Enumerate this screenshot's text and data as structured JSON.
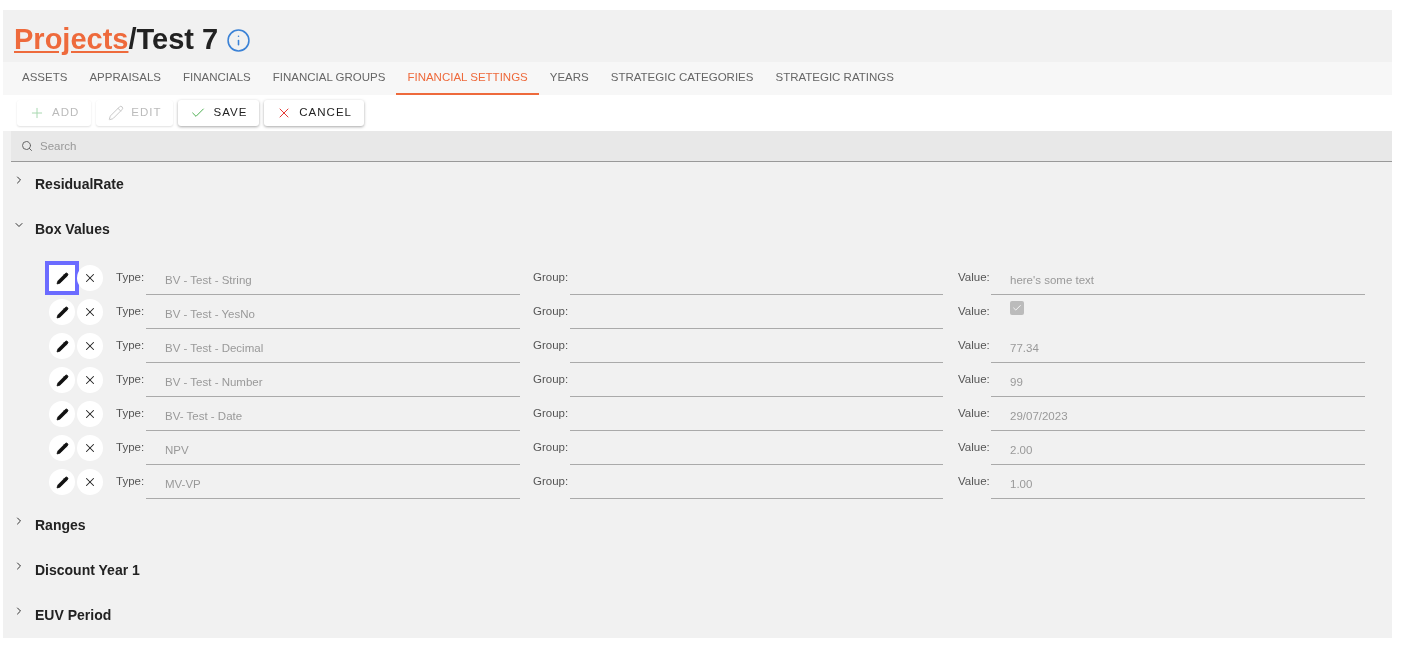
{
  "breadcrumb": {
    "link": "Projects",
    "separator": "/",
    "title": "Test 7"
  },
  "tabs": [
    {
      "label": "ASSETS",
      "selected": false
    },
    {
      "label": "APPRAISALS",
      "selected": false
    },
    {
      "label": "FINANCIALS",
      "selected": false
    },
    {
      "label": "FINANCIAL GROUPS",
      "selected": false
    },
    {
      "label": "FINANCIAL SETTINGS",
      "selected": true
    },
    {
      "label": "YEARS",
      "selected": false
    },
    {
      "label": "STRATEGIC CATEGORIES",
      "selected": false
    },
    {
      "label": "STRATEGIC RATINGS",
      "selected": false
    }
  ],
  "toolbar": [
    {
      "kind": "add",
      "label": "ADD",
      "disabled": true
    },
    {
      "kind": "edit",
      "label": "EDIT",
      "disabled": true
    },
    {
      "kind": "save",
      "label": "SAVE",
      "disabled": false
    },
    {
      "kind": "cancel",
      "label": "CANCEL",
      "disabled": false
    }
  ],
  "search": {
    "placeholder": "Search"
  },
  "sections": [
    {
      "title": "ResidualRate",
      "expanded": false
    },
    {
      "title": "Box Values",
      "expanded": true,
      "rows": [
        {
          "focused": true,
          "type_label": "Type:",
          "type": "BV - Test - String",
          "group_label": "Group:",
          "value_label": "Value:",
          "kind": "text",
          "value": "here's some text"
        },
        {
          "focused": false,
          "type_label": "Type:",
          "type": "BV - Test - YesNo",
          "group_label": "Group:",
          "value_label": "Value:",
          "kind": "checkbox",
          "checked": true
        },
        {
          "focused": false,
          "type_label": "Type:",
          "type": "BV - Test - Decimal",
          "group_label": "Group:",
          "value_label": "Value:",
          "kind": "text",
          "value": "77.34"
        },
        {
          "focused": false,
          "type_label": "Type:",
          "type": "BV - Test -  Number",
          "group_label": "Group:",
          "value_label": "Value:",
          "kind": "text",
          "value": "99"
        },
        {
          "focused": false,
          "type_label": "Type:",
          "type": "BV- Test - Date",
          "group_label": "Group:",
          "value_label": "Value:",
          "kind": "text",
          "value": "29/07/2023"
        },
        {
          "focused": false,
          "type_label": "Type:",
          "type": "NPV",
          "group_label": "Group:",
          "value_label": "Value:",
          "kind": "text",
          "value": "2.00"
        },
        {
          "focused": false,
          "type_label": "Type:",
          "type": "MV-VP",
          "group_label": "Group:",
          "value_label": "Value:",
          "kind": "text",
          "value": "1.00"
        }
      ]
    },
    {
      "title": "Ranges",
      "expanded": false
    },
    {
      "title": "Discount Year 1",
      "expanded": false
    },
    {
      "title": "EUV Period",
      "expanded": false
    }
  ]
}
